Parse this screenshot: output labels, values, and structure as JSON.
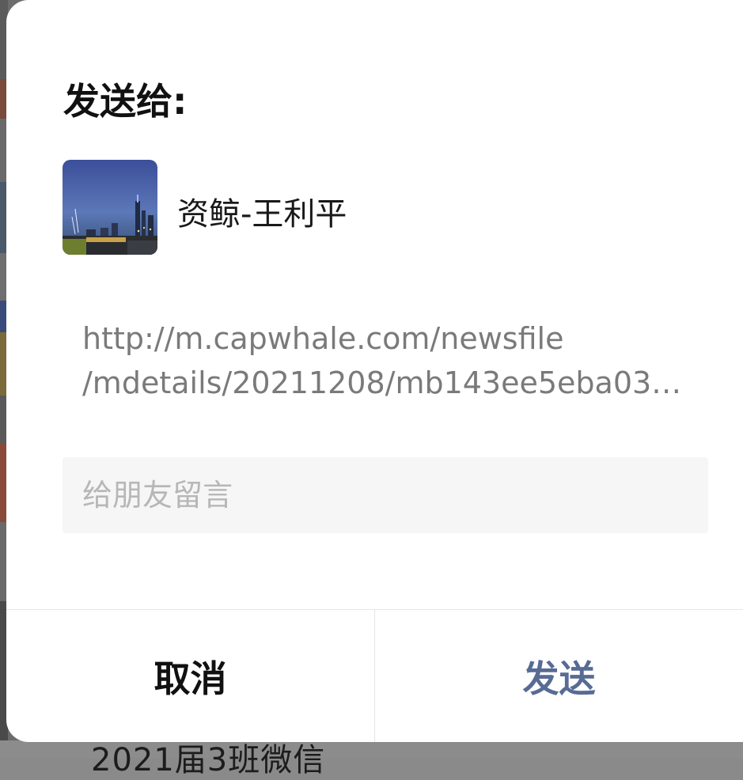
{
  "dialog": {
    "title": "发送给:"
  },
  "recipient": {
    "name": "资鲸-王利平",
    "avatar_icon": "city-night-skyline-avatar"
  },
  "link_preview": {
    "line1": "http://m.capwhale.com/newsfile",
    "line2": "/mdetails/20211208/mb143ee5eba03…"
  },
  "message": {
    "placeholder": "给朋友留言",
    "value": ""
  },
  "footer": {
    "cancel_label": "取消",
    "send_label": "发送"
  },
  "background": {
    "partial_text": "2021届3班微信"
  },
  "colors": {
    "send_accent": "#576b95",
    "title_text": "#111111",
    "link_text": "#7a7a7a",
    "input_bg": "#f6f6f6",
    "placeholder_text": "#b7b7b7"
  }
}
